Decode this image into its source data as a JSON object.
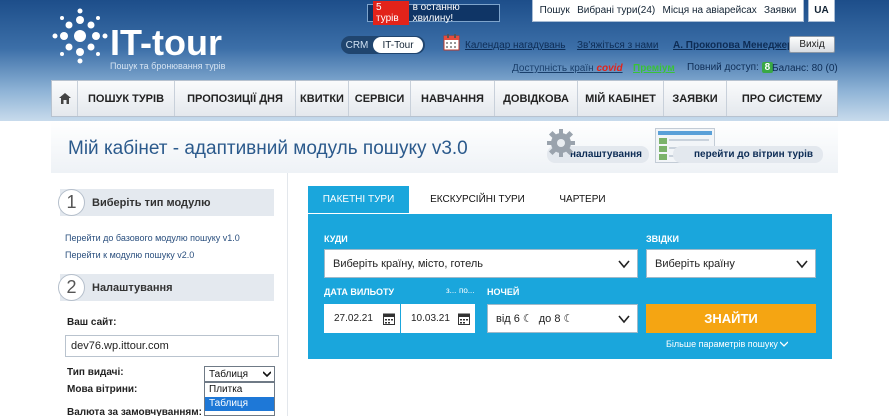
{
  "header": {
    "logo_text": "IT-tour",
    "logo_sub": "Пошук та бронювання турів",
    "promo_count": "5 турів",
    "promo_text": "в останню хвилину!",
    "top_menu": [
      "Пошук",
      "Вибрані тури(24)",
      "Місця на авіарейсах",
      "Заявки"
    ],
    "lang": "UA",
    "crm_label": "CRM",
    "ittour_label": "IT-Tour",
    "calendar_link": "Календар нагадувань",
    "contact_link": "Зв'яжіться з нами",
    "user": "А. Прокопова Менеджер",
    "exit": "Вихід",
    "countries_text": "Доступність країн",
    "covid": "covid",
    "premium": "Преміум",
    "full_access": "Повний доступ:",
    "full_access_count": "8",
    "balance": "Баланс: 80 (0)"
  },
  "nav": [
    "ПОШУК ТУРІВ",
    "ПРОПОЗИЦІЇ ДНЯ",
    "КВИТКИ",
    "СЕРВІСИ",
    "НАВЧАННЯ",
    "ДОВІДКОВА",
    "МІЙ КАБІНЕТ",
    "ЗАЯВКИ",
    "ПРО СИСТЕМУ"
  ],
  "page": {
    "title": "Мій кабінет - адаптивний модуль пошуку v3.0",
    "settings_btn": "налаштування",
    "showcase_btn": "перейти до вітрин турів"
  },
  "sidebar": {
    "step1_num": "1",
    "step1_label": "Виберіть тип модулю",
    "link1": "Перейти до базового модулю пошуку v1.0",
    "link2": "Перейти к модулю пошуку v2.0",
    "step2_num": "2",
    "step2_label": "Налаштування",
    "site_label": "Ваш сайт:",
    "site_value": "dev76.wp.ittour.com",
    "type_label": "Тип видачі:",
    "type_value": "Таблиця",
    "type_options": [
      "Плитка",
      "Таблиця"
    ],
    "lang_label": "Мова вітрини:",
    "currency_label": "Валюта за замовчуванням:"
  },
  "search": {
    "tabs": [
      "ПАКЕТНІ ТУРИ",
      "ЕКСКУРСІЙНІ ТУРИ",
      "ЧАРТЕРИ"
    ],
    "where_label": "КУДИ",
    "where_placeholder": "Виберіть країну, місто, готель",
    "from_label": "ЗВІДКИ",
    "from_placeholder": "Виберіть країну",
    "date_label": "ДАТА ВИЛЬОТУ",
    "date_from_small": "з...",
    "date_to_small": "по...",
    "date_from": "27.02.21",
    "date_to": "10.03.21",
    "nights_label": "НОЧЕЙ",
    "nights_from": "від 6",
    "nights_to": "до 8",
    "find": "ЗНАЙТИ",
    "more": "Більше параметрів пошуку"
  },
  "colors": {
    "accent": "#1aa6dc",
    "find": "#f5a512",
    "header_dark": "#1d4e8a"
  }
}
